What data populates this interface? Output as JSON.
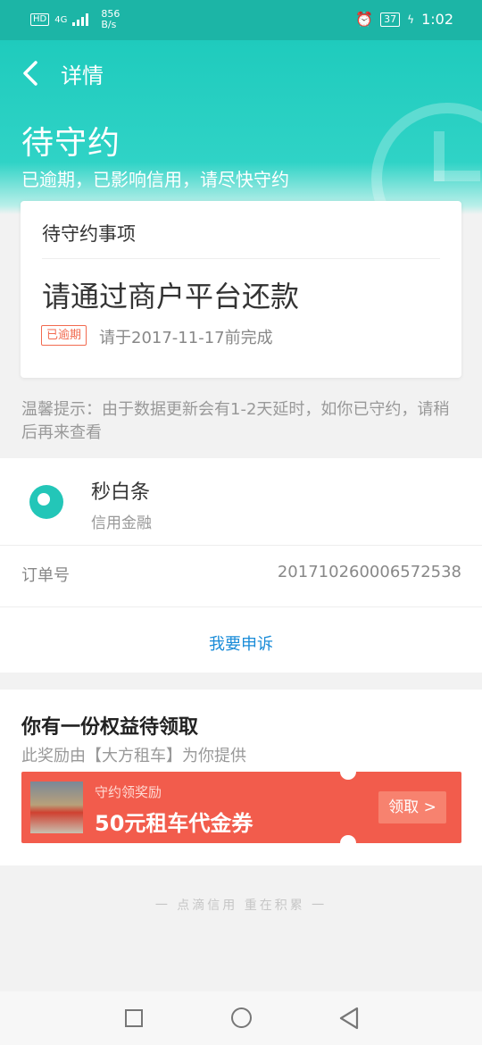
{
  "status_bar": {
    "hd": "HD",
    "network": "4G",
    "speed_value": "856",
    "speed_unit": "B/s",
    "alarm_icon": "alarm-icon",
    "battery": "37",
    "time": "1:02"
  },
  "header": {
    "nav_title": "详情",
    "title": "待守约",
    "subtitle": "已逾期，已影响信用，请尽快守约"
  },
  "card": {
    "heading": "待守约事项",
    "main": "请通过商户平台还款",
    "badge": "已逾期",
    "due": "请于2017-11-17前完成"
  },
  "tip": "温馨提示：由于数据更新会有1-2天延时，如你已守约，请稍后再来查看",
  "merchant": {
    "name": "秒白条",
    "type": "信用金融",
    "order_label": "订单号",
    "order_value": "201710260006572538",
    "appeal": "我要申诉"
  },
  "benefit": {
    "title": "你有一份权益待领取",
    "subtitle": "此奖励由【大方租车】为你提供",
    "coupon_small": "守约领奖励",
    "coupon_big": "50元租车代金券",
    "coupon_button": "领取 >"
  },
  "footer_slogan": "一 点滴信用  重在积累 一",
  "colors": {
    "accent": "#1fcbbd",
    "coupon": "#f25c4c",
    "link": "#1a8cd8"
  }
}
